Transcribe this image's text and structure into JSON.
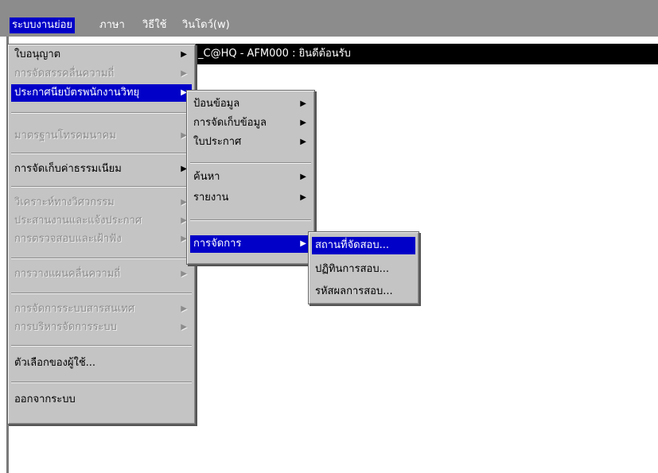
{
  "menubar": {
    "items": [
      "ระบบงานย่อย",
      "ภาษา",
      "วิธีใช้",
      "วินโดว์(w)"
    ]
  },
  "window": {
    "title": "_C@HQ - AFM000 : ยินดีต้อนรับ"
  },
  "menu1": {
    "items": [
      {
        "label": "ใบอนุญาต",
        "state": "normal",
        "arrow": "▶"
      },
      {
        "label": "การจัดสรรคลื่นความถี่",
        "state": "disabled",
        "arrow": "▶"
      },
      {
        "label": "ประกาศนียบัตรพนักงานวิทยุ",
        "state": "selected",
        "arrow": "▶"
      },
      {
        "label": "มาตรฐานโทรคมนาคม",
        "state": "disabled",
        "arrow": "▶"
      },
      {
        "label": "การจัดเก็บค่าธรรมเนียม",
        "state": "normal",
        "arrow": "▶"
      },
      {
        "label": "วิเคราะห์ทางวิศวกรรม",
        "state": "disabled",
        "arrow": "▶"
      },
      {
        "label": "ประสานงานและแจ้งประกาศ",
        "state": "disabled",
        "arrow": "▶"
      },
      {
        "label": "การตรวจสอบและเฝ้าฟัง",
        "state": "disabled",
        "arrow": "▶"
      },
      {
        "label": "การวางแผนคลื่นความถี่",
        "state": "disabled",
        "arrow": "▶"
      },
      {
        "label": "การจัดการระบบสารสนเทศ",
        "state": "disabled",
        "arrow": "▶"
      },
      {
        "label": "การบริหารจัดการระบบ",
        "state": "disabled",
        "arrow": "▶"
      },
      {
        "label": "ตัวเลือกของผู้ใช้...",
        "state": "normal",
        "arrow": ""
      },
      {
        "label": "ออกจากระบบ",
        "state": "normal",
        "arrow": ""
      }
    ]
  },
  "menu2": {
    "items": [
      {
        "label": "ป้อนข้อมูล",
        "state": "normal",
        "arrow": "▶"
      },
      {
        "label": "การจัดเก็บข้อมูล",
        "state": "normal",
        "arrow": "▶"
      },
      {
        "label": "ใบประกาศ",
        "state": "normal",
        "arrow": "▶"
      },
      {
        "label": "ค้นหา",
        "state": "normal",
        "arrow": "▶"
      },
      {
        "label": "รายงาน",
        "state": "normal",
        "arrow": "▶"
      },
      {
        "label": "การจัดการ",
        "state": "selected",
        "arrow": "▶"
      }
    ]
  },
  "menu3": {
    "items": [
      {
        "label": "สถานที่จัดสอบ...",
        "state": "selected"
      },
      {
        "label": "ปฏิทินการสอบ...",
        "state": "normal"
      },
      {
        "label": "รหัสผลการสอบ...",
        "state": "normal"
      }
    ]
  }
}
